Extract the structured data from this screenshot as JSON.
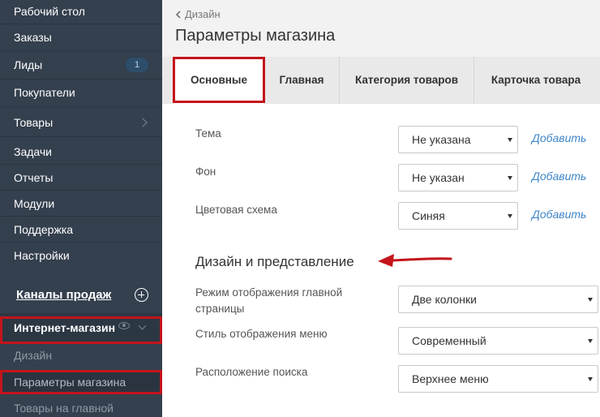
{
  "sidebar": {
    "items": [
      {
        "label": "Рабочий стол"
      },
      {
        "label": "Заказы"
      },
      {
        "label": "Лиды",
        "badge": "1"
      },
      {
        "label": "Покупатели"
      },
      {
        "label": "Товары"
      },
      {
        "label": "Задачи"
      },
      {
        "label": "Отчеты"
      },
      {
        "label": "Модули"
      },
      {
        "label": "Поддержка"
      },
      {
        "label": "Настройки"
      }
    ],
    "channels_title": "Каналы продаж",
    "store_label": "Интернет-магазин",
    "sub_items": [
      {
        "label": "Дизайн"
      },
      {
        "label": "Параметры магазина"
      },
      {
        "label": "Товары на главной"
      }
    ]
  },
  "header": {
    "breadcrumb": "Дизайн",
    "title": "Параметры магазина"
  },
  "tabs": [
    {
      "label": "Основные",
      "active": true
    },
    {
      "label": "Главная"
    },
    {
      "label": "Категория товаров"
    },
    {
      "label": "Карточка товара"
    }
  ],
  "form": {
    "theme": {
      "label": "Тема",
      "value": "Не указана",
      "link": "Добавить"
    },
    "background": {
      "label": "Фон",
      "value": "Не указан",
      "link": "Добавить"
    },
    "color_scheme": {
      "label": "Цветовая схема",
      "value": "Синяя",
      "link": "Добавить"
    },
    "section_title": "Дизайн и представление",
    "home_mode": {
      "label": "Режим отображения главной страницы",
      "value": "Две колонки"
    },
    "menu_style": {
      "label": "Стиль отображения меню",
      "value": "Современный"
    },
    "search_position": {
      "label": "Расположение поиска",
      "value": "Верхнее меню"
    }
  },
  "colors": {
    "sidebar_bg": "#34404e",
    "highlight_red": "#c4141b",
    "link_blue": "#3f86c8"
  }
}
